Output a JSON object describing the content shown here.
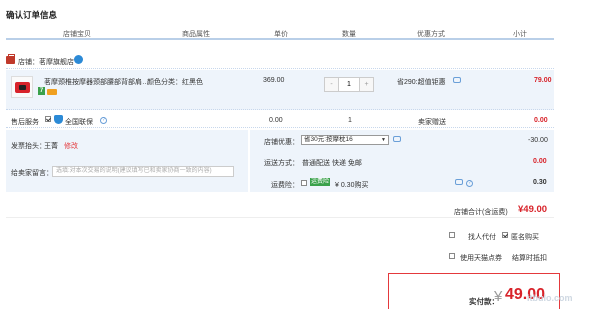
{
  "page_title": "确认订单信息",
  "table_header": {
    "col_item": "店铺宝贝",
    "col_attr": "商品属性",
    "col_price": "单价",
    "col_qty": "数量",
    "col_discount": "优惠方式",
    "col_subtotal": "小计"
  },
  "shop": {
    "name": "店铺：茗摩旗舰店"
  },
  "item": {
    "name": "茗摩颈椎按摩器颈部腰部背部肩…",
    "attr": "颜色分类：红黑色",
    "price": "369.00",
    "qty_minus": "-",
    "qty_value": "1",
    "qty_plus": "+",
    "discount": "省290:超值钜惠",
    "subtotal": "79.00",
    "badge_seven": "7"
  },
  "service": {
    "label": "售后服务",
    "option": "全国联保",
    "price": "0.00",
    "qty": "1",
    "discount": "卖家赠送",
    "subtotal": "0.00"
  },
  "invoice": {
    "label": "发票抬头：",
    "name": "王菁",
    "edit": "修改"
  },
  "message": {
    "label": "给卖家留言：",
    "placeholder": "选填:对本次交易的说明(建议填写已和卖家协商一致的内容)"
  },
  "shop_discount": {
    "label": "店铺优惠：",
    "selected": "省30元:按摩枕16",
    "amount": "-30.00"
  },
  "shipping": {
    "label": "运送方式：",
    "method": "普通配送 快递 免邮",
    "amount": "0.00"
  },
  "insurance": {
    "label": "运费险：",
    "tag": "运费险",
    "text": "¥ 0.30购买",
    "amount": "0.30"
  },
  "shop_total": {
    "label": "店铺合计(含运费)",
    "amount": "¥49.00"
  },
  "options": {
    "proxy_pay": "找人代付",
    "anonymous": "匿名购买",
    "tmall_points": "使用天猫点券",
    "rules": "结算时抵扣"
  },
  "payment": {
    "label": "实付款：",
    "currency": "¥",
    "amount": "49.00"
  },
  "watermark": "itbulo.com",
  "colors": {
    "accent_red": "#d8232a",
    "panel_blue": "#eef4fb",
    "header_line": "#b9cfe8"
  }
}
